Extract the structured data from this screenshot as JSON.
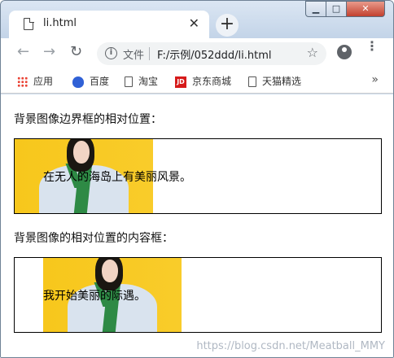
{
  "browser": {
    "tab_title": "li.html",
    "tab_close": "✕",
    "new_tab": "+",
    "window_controls": {
      "minimize": "▁",
      "maximize": "□",
      "close": "✕"
    },
    "nav": {
      "back": "←",
      "forward": "→",
      "reload": "↻"
    },
    "address": {
      "scheme": "文件",
      "url": "F:/示例/052ddd/li.html",
      "star": "☆"
    },
    "menu": "⋮",
    "bookmarks": [
      {
        "label": "应用",
        "icon": "apps-grid-icon"
      },
      {
        "label": "百度",
        "icon": "baidu-paw-icon"
      },
      {
        "label": "淘宝",
        "icon": "document-icon"
      },
      {
        "label": "京东商城",
        "icon": "jd-logo-icon"
      },
      {
        "label": "天猫精选",
        "icon": "document-icon"
      }
    ],
    "bookmarks_more": "»"
  },
  "page": {
    "section1": {
      "label": "背景图像边界框的相对位置：",
      "text": "在无人的海岛上有美丽风景。"
    },
    "section2": {
      "label": "背景图像的相对位置的内容框：",
      "text": "我开始美丽的际遇。"
    }
  },
  "watermark": "https://blog.csdn.net/Meatball_MMY"
}
